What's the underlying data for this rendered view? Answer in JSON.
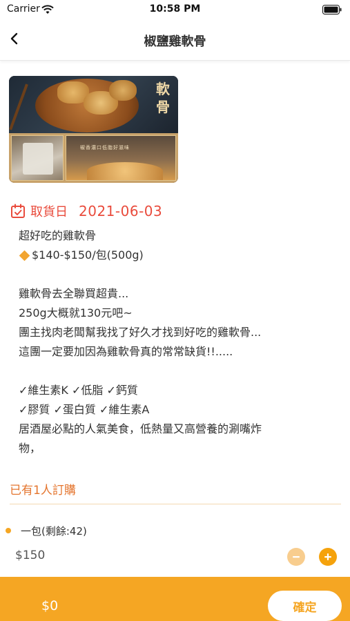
{
  "status_bar": {
    "carrier": "Carrier",
    "time": "10:58 PM"
  },
  "nav": {
    "title": "椒鹽雞軟骨"
  },
  "product_image": {
    "overlay_text": "軟骨",
    "banner_text": "椒香濃口低脂好滋味"
  },
  "pickup": {
    "label": "取貨日",
    "date": "2021-06-03"
  },
  "description": {
    "lines": [
      "超好吃的雞軟骨",
      "$140-$150/包(500g)",
      "",
      "雞軟骨去全聯買超貴...",
      "250g大概就130元吧~",
      "團主找肉老闆幫我找了好久才找到好吃的雞軟骨...",
      "這團一定要加因為雞軟骨真的常常缺貨!!.....",
      "",
      "✓維生素K ✓低脂 ✓鈣質",
      "✓膠質 ✓蛋白質 ✓維生素A",
      "居酒屋必點的人氣美食，低熱量又高營養的涮嘴炸",
      "物，"
    ]
  },
  "order_count": "已有1人訂購",
  "option": {
    "label": "一包(剩餘:42)",
    "price": "$150"
  },
  "bottom_bar": {
    "total": "$0",
    "confirm_label": "確定"
  },
  "colors": {
    "accent_orange": "#f5a623",
    "date_red": "#e94b3c"
  }
}
